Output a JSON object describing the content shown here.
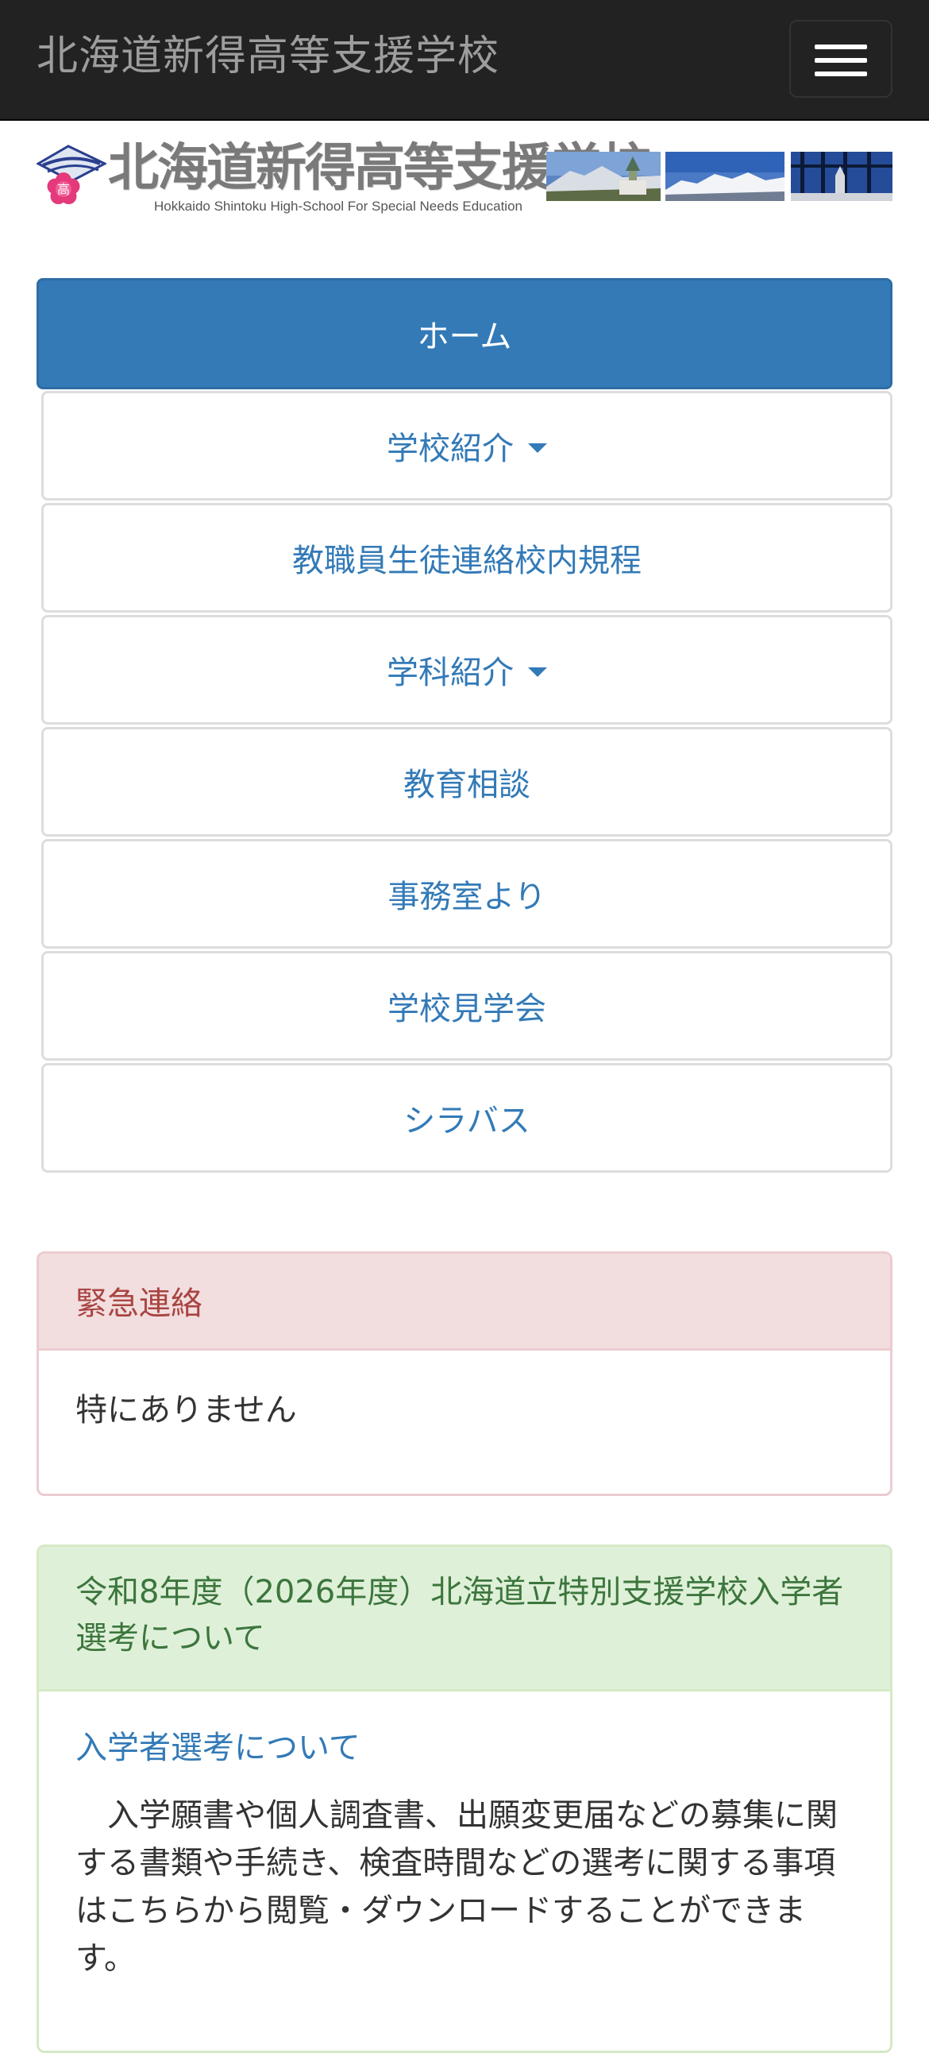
{
  "navbar": {
    "brand": "北海道新得高等支援学校"
  },
  "banner": {
    "logo_title": "北海道新得高等支援学校",
    "logo_subtitle": "Hokkaido Shintoku High-School For Special Needs Education",
    "emblem_char": "高"
  },
  "nav": {
    "items": [
      {
        "label": "ホーム",
        "active": true,
        "dropdown": false
      },
      {
        "label": "学校紹介",
        "active": false,
        "dropdown": true
      },
      {
        "label": "教職員生徒連絡校内規程",
        "active": false,
        "dropdown": false
      },
      {
        "label": "学科紹介",
        "active": false,
        "dropdown": true
      },
      {
        "label": "教育相談",
        "active": false,
        "dropdown": false
      },
      {
        "label": "事務室より",
        "active": false,
        "dropdown": false
      },
      {
        "label": "学校見学会",
        "active": false,
        "dropdown": false
      },
      {
        "label": "シラバス",
        "active": false,
        "dropdown": false
      }
    ]
  },
  "emergency": {
    "title": "緊急連絡",
    "body": "特にありません"
  },
  "admission": {
    "title": "令和8年度（2026年度）北海道立特別支援学校入学者選考について",
    "link": "入学者選考について",
    "body": "入学願書や個人調査書、出願変更届などの募集に関する書類や手続き、検査時間などの選考に関する事項はこちらから閲覧・ダウンロードすることができます。"
  },
  "colors": {
    "navbar_bg": "#222222",
    "primary": "#337ab7",
    "danger_bg": "#f2dede",
    "danger_text": "#a94442",
    "success_bg": "#dff0d8",
    "success_text": "#3c763d"
  }
}
